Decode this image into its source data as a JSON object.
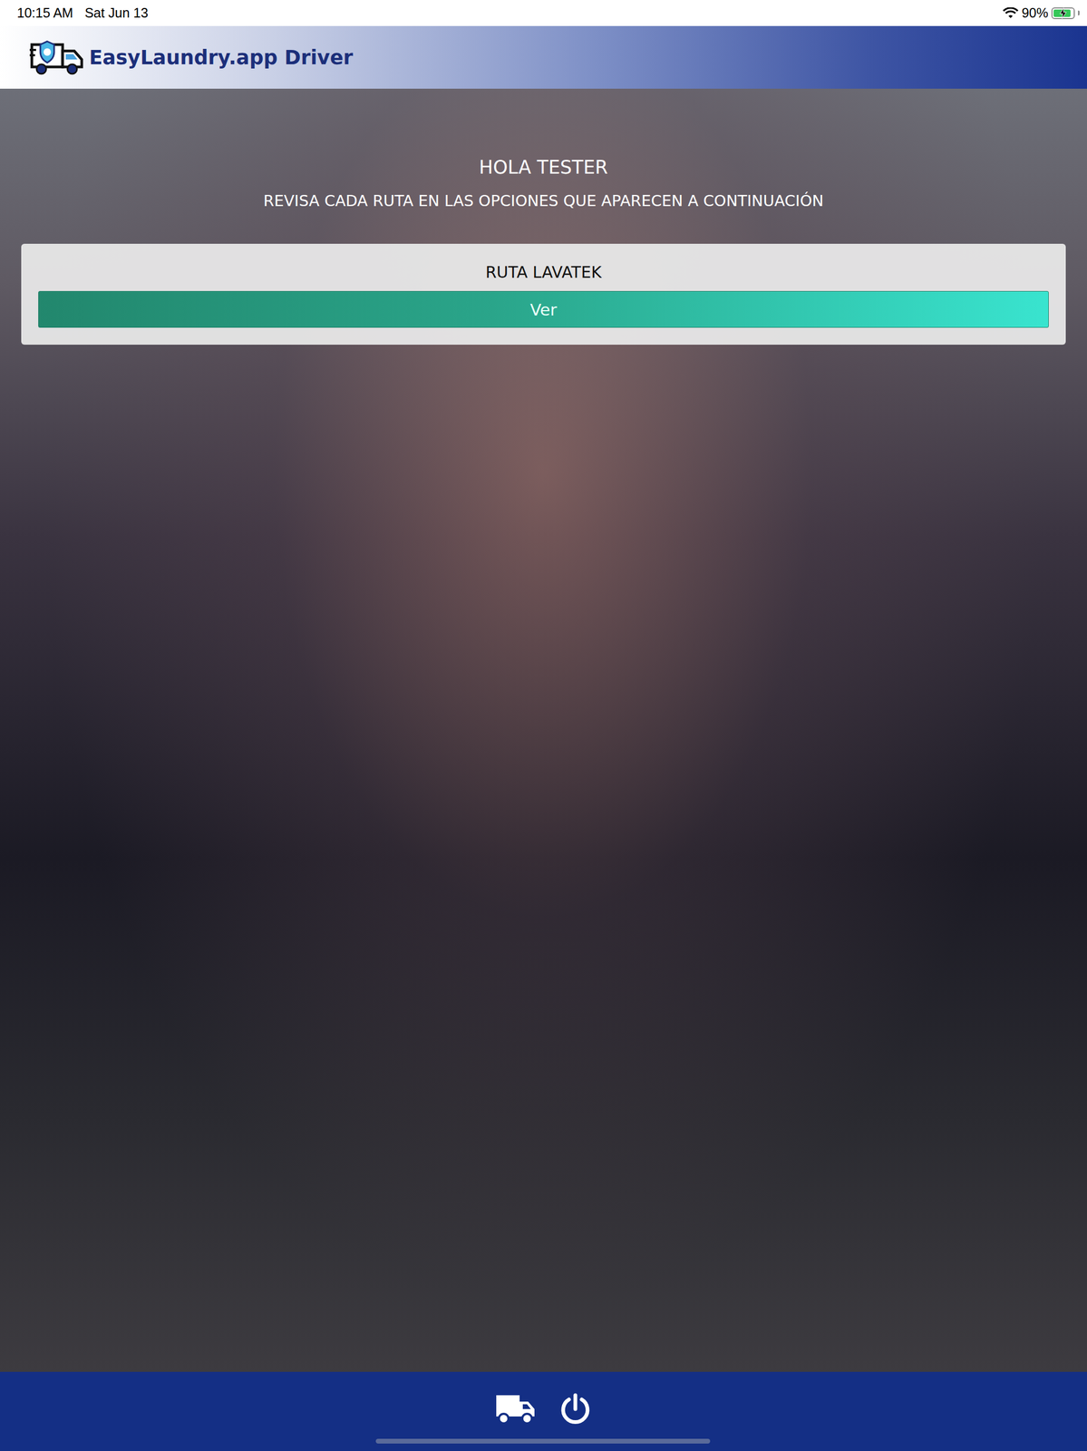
{
  "status_bar": {
    "time": "10:15 AM",
    "date": "Sat Jun 13",
    "battery": "90%",
    "level": 0.9,
    "charging": true
  },
  "header": {
    "title": "EasyLaundry.app Driver"
  },
  "greeting": "HOLA TESTER",
  "subtitle": "REVISA CADA RUTA EN LAS OPCIONES QUE APARECEN A CONTINUACIÓN",
  "routes": [
    {
      "title": "RUTA LAVATEK",
      "button": "Ver"
    }
  ]
}
